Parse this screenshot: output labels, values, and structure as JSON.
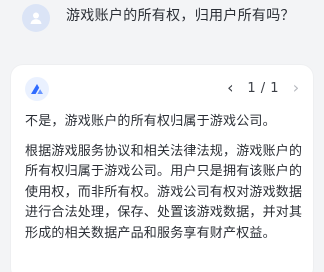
{
  "question": {
    "text": "游戏账户的所有权，归用户所有吗？",
    "avatar_icon": "user-avatar-icon"
  },
  "answer": {
    "logo_icon": "ai-assistant-logo-icon",
    "pager": {
      "prev_icon": "chevron-left-icon",
      "next_icon": "chevron-right-icon",
      "label": "1 / 1"
    },
    "paragraphs": [
      "不是，游戏账户的所有权归属于游戏公司。",
      "根据游戏服务协议和相关法律法规，游戏账户的所有权归属于游戏公司。用户只是拥有该账户的使用权，而非所有权。游戏公司有权对游戏数据进行合法处理，保存、处置该游戏数据，并对其形成的相关数据产品和服务享有财产权益。"
    ]
  },
  "colors": {
    "background": "#f3f4f6",
    "card": "#ffffff",
    "text": "#2b2f36",
    "logo_accent": "#2f6bff",
    "disabled": "#b5b8be"
  }
}
